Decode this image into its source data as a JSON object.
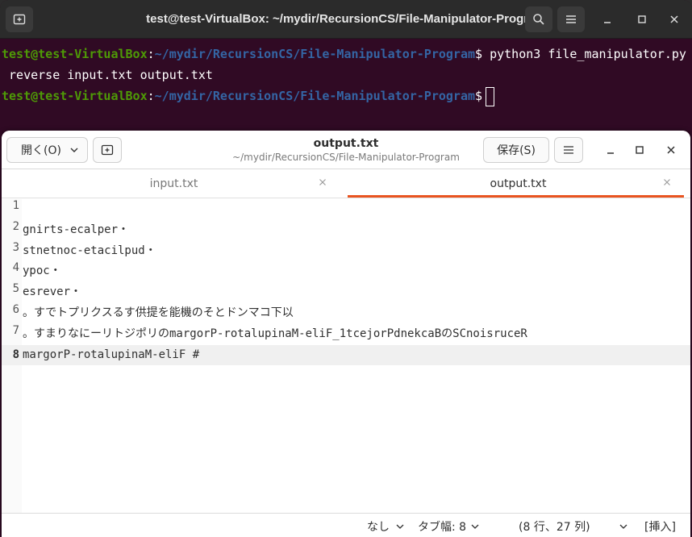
{
  "terminal": {
    "title": "test@test-VirtualBox: ~/mydir/RecursionCS/File-Manipulator-Program",
    "lines": {
      "l1": {
        "user": "test@test-VirtualBox",
        "sep": ":",
        "path": "~/mydir/RecursionCS/File-Manipulator-Program",
        "dollar": "$",
        "command": " python3 file_manipulator.py"
      },
      "l2": {
        "text": " reverse input.txt output.txt"
      },
      "l3": {
        "user": "test@test-VirtualBox",
        "sep": ":",
        "path": "~/mydir/RecursionCS/File-Manipulator-Program",
        "dollar": "$"
      }
    }
  },
  "editor": {
    "open_label": "開く(O)",
    "title": "output.txt",
    "subtitle": "~/mydir/RecursionCS/File-Manipulator-Program",
    "save_label": "保存(S)",
    "tabs": [
      {
        "label": "input.txt",
        "active": false
      },
      {
        "label": "output.txt",
        "active": true
      }
    ],
    "lines": [
      {
        "num": "1",
        "text": ""
      },
      {
        "num": "2",
        "text": "gnirts-ecalper・"
      },
      {
        "num": "3",
        "text": "stnetnoc-etacilpud・"
      },
      {
        "num": "4",
        "text": "ypoc・"
      },
      {
        "num": "5",
        "text": "esrever・"
      },
      {
        "num": "6",
        "text": "。すでトプリクスるす供提を能機のそとドンマコ下以"
      },
      {
        "num": "7",
        "text": "。すまりなにーリトジポリのmargorP-rotalupinaM-eliF_1tcejorPdnekcaBのSCnoisruceR"
      },
      {
        "num": "8",
        "text": "margorP-rotalupinaM-eliF #"
      }
    ],
    "current_line": 8,
    "status": {
      "syntax": "なし",
      "tab_width": "タブ幅: 8",
      "position": "(8 行、27 列)",
      "insert_mode": "[挿入]"
    }
  },
  "colors": {
    "terminal_bg": "#300a24",
    "prompt_user": "#4e9a06",
    "prompt_path": "#3465a4",
    "accent": "#e95420"
  }
}
